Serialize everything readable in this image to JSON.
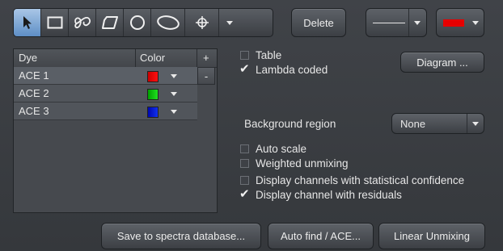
{
  "toolbar": {
    "tools": [
      "arrow-icon",
      "rectangle-icon",
      "freehand-icon",
      "polygon-icon",
      "circle-icon",
      "ellipse-icon",
      "crosshair-icon"
    ],
    "delete_label": "Delete",
    "line_color": "#e60000"
  },
  "dye_table": {
    "headers": {
      "dye": "Dye",
      "color": "Color",
      "add": "+",
      "remove": "-"
    },
    "rows": [
      {
        "name": "ACE 1",
        "color": "#cc0000"
      },
      {
        "name": "ACE 2",
        "color": "#00c000"
      },
      {
        "name": "ACE 3",
        "color": "#0010d0"
      }
    ]
  },
  "options": {
    "table": {
      "label": "Table",
      "checked": false
    },
    "lambda_coded": {
      "label": "Lambda coded",
      "checked": true
    },
    "diagram_label": "Diagram ...",
    "background_region_label": "Background region",
    "background_region_value": "None",
    "auto_scale": {
      "label": "Auto scale",
      "checked": false
    },
    "weighted_unmixing": {
      "label": "Weighted unmixing",
      "checked": false
    },
    "stat_confidence": {
      "label": "Display channels with statistical confidence",
      "checked": false
    },
    "residuals": {
      "label": "Display channel with residuals",
      "checked": true
    }
  },
  "footer": {
    "save_label": "Save to spectra database...",
    "autofind_label": "Auto find / ACE...",
    "linear_label": "Linear Unmixing"
  }
}
